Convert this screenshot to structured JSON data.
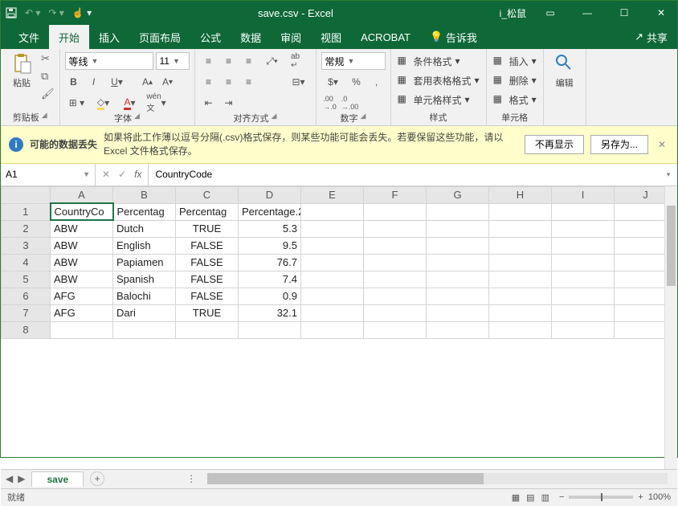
{
  "title": "save.csv  -  Excel",
  "user": "i_松鼠",
  "tabs": [
    "文件",
    "开始",
    "插入",
    "页面布局",
    "公式",
    "数据",
    "审阅",
    "视图",
    "ACROBAT"
  ],
  "tellme": "告诉我",
  "share": "共享",
  "ribbon": {
    "clipboard": {
      "paste": "粘贴",
      "label": "剪贴板"
    },
    "font": {
      "name": "等线",
      "size": "11",
      "label": "字体"
    },
    "align": {
      "label": "对齐方式"
    },
    "number": {
      "format": "常规",
      "label": "数字"
    },
    "styles": {
      "cond": "条件格式",
      "table": "套用表格格式",
      "cell": "单元格样式",
      "label": "样式"
    },
    "cells": {
      "insert": "插入",
      "delete": "删除",
      "format": "格式",
      "label": "单元格"
    },
    "edit": {
      "label": "编辑"
    }
  },
  "warn": {
    "title": "可能的数据丢失",
    "msg": "如果将此工作薄以逗号分隔(.csv)格式保存，则某些功能可能会丢失。若要保留这些功能，请以 Excel 文件格式保存。",
    "dismiss": "不再显示",
    "saveas": "另存为..."
  },
  "namebox": "A1",
  "formula": "CountryCode",
  "cols": [
    "A",
    "B",
    "C",
    "D",
    "E",
    "F",
    "G",
    "H",
    "I",
    "J"
  ],
  "rows": [
    "1",
    "2",
    "3",
    "4",
    "5",
    "6",
    "7",
    "8"
  ],
  "headers_row": [
    "CountryCo",
    "Percentag",
    "Percentag",
    "Percentage.2"
  ],
  "data": [
    [
      "ABW",
      "Dutch",
      "TRUE",
      "5.3"
    ],
    [
      "ABW",
      "English",
      "FALSE",
      "9.5"
    ],
    [
      "ABW",
      "Papiamen",
      "FALSE",
      "76.7"
    ],
    [
      "ABW",
      "Spanish",
      "FALSE",
      "7.4"
    ],
    [
      "AFG",
      "Balochi",
      "FALSE",
      "0.9"
    ],
    [
      "AFG",
      "Dari",
      "TRUE",
      "32.1"
    ]
  ],
  "sheet": "save",
  "status": "就绪",
  "zoom": "100%"
}
